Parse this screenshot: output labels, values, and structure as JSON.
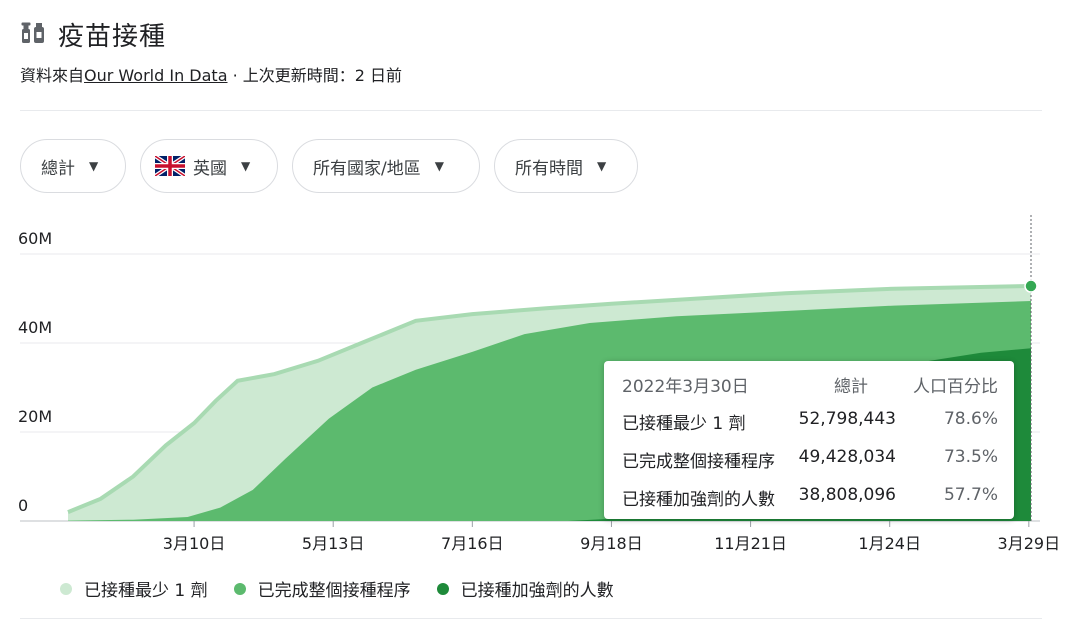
{
  "header": {
    "title": "疫苗接種",
    "source_prefix": "資料來自",
    "source_link": "Our World In Data",
    "source_suffix": " · 上次更新時間：2 日前"
  },
  "filters": {
    "metric": "總計",
    "country": "英國",
    "region": "所有國家/地區",
    "time": "所有時間"
  },
  "icons": {
    "vaccine": "vaccine-icon",
    "flag": "uk-flag-icon",
    "caret": "caret-down-icon"
  },
  "colors": {
    "light": "#cde9d2",
    "light_line": "#a8dab2",
    "mid": "#5cba6e",
    "dark": "#1e8a3a",
    "accent": "#34a853"
  },
  "tooltip": {
    "date": "2022年3月30日",
    "col_total": "總計",
    "col_pct": "人口百分比",
    "rows": [
      {
        "label": "已接種最少 1 劑",
        "value": "52,798,443",
        "pct": "78.6%"
      },
      {
        "label": "已完成整個接種程序",
        "value": "49,428,034",
        "pct": "73.5%"
      },
      {
        "label": "已接種加強劑的人數",
        "value": "38,808,096",
        "pct": "57.7%"
      }
    ]
  },
  "chart_data": {
    "type": "area",
    "yticks": [
      "0",
      "20M",
      "40M",
      "60M"
    ],
    "ylim": [
      0,
      68000000
    ],
    "x_tick_labels": [
      "3月10日",
      "5月13日",
      "7月16日",
      "9月18日",
      "11月21日",
      "1月24日",
      "3月29日"
    ],
    "x_tick_days": [
      58,
      122,
      186,
      250,
      314,
      378,
      442
    ],
    "x_range_days": [
      0,
      443
    ],
    "series": [
      {
        "name": "已接種最少 1 劑",
        "color": "#cde9d2",
        "points": [
          [
            0,
            2000000
          ],
          [
            15,
            5000000
          ],
          [
            30,
            10000000
          ],
          [
            45,
            17000000
          ],
          [
            58,
            22000000
          ],
          [
            68,
            27000000
          ],
          [
            78,
            31500000
          ],
          [
            95,
            33000000
          ],
          [
            115,
            36000000
          ],
          [
            135,
            40000000
          ],
          [
            160,
            45000000
          ],
          [
            186,
            46500000
          ],
          [
            220,
            47800000
          ],
          [
            250,
            48800000
          ],
          [
            290,
            50000000
          ],
          [
            330,
            51200000
          ],
          [
            380,
            52200000
          ],
          [
            443,
            52798443
          ]
        ]
      },
      {
        "name": "已完成整個接種程序",
        "color": "#5cba6e",
        "points": [
          [
            0,
            100000
          ],
          [
            30,
            300000
          ],
          [
            55,
            900000
          ],
          [
            70,
            3000000
          ],
          [
            85,
            7000000
          ],
          [
            100,
            14000000
          ],
          [
            120,
            23000000
          ],
          [
            140,
            30000000
          ],
          [
            160,
            34000000
          ],
          [
            186,
            38000000
          ],
          [
            210,
            42000000
          ],
          [
            240,
            44500000
          ],
          [
            280,
            46000000
          ],
          [
            330,
            47200000
          ],
          [
            380,
            48400000
          ],
          [
            443,
            49428034
          ]
        ]
      },
      {
        "name": "已接種加強劑的人數",
        "color": "#1e8a3a",
        "points": [
          [
            0,
            0
          ],
          [
            230,
            0
          ],
          [
            250,
            500000
          ],
          [
            270,
            3000000
          ],
          [
            290,
            8000000
          ],
          [
            310,
            14000000
          ],
          [
            330,
            22000000
          ],
          [
            350,
            30000000
          ],
          [
            370,
            33500000
          ],
          [
            390,
            35500000
          ],
          [
            420,
            37800000
          ],
          [
            443,
            38808096
          ]
        ]
      }
    ],
    "legend": [
      "已接種最少 1 劑",
      "已完成整個接種程序",
      "已接種加強劑的人數"
    ],
    "legend_placement": "bottom"
  }
}
